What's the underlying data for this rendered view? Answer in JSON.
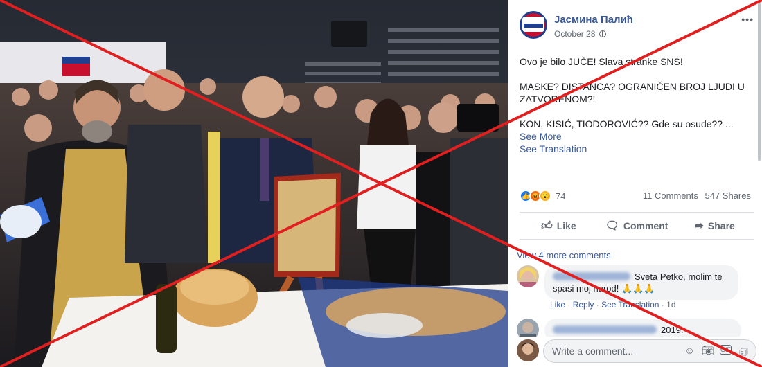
{
  "post": {
    "author": "Јасмина Палић",
    "date": "October 28",
    "paragraphs": [
      "Ovo je bilo JUČE! Slava stranke SNS!",
      "MASKE? DISTANCA? OGRANIČEN BROJ LJUDI U ZATVORENOM?!",
      "KON, KISIĆ, TIODOROVIĆ?? Gde su osude?? ..."
    ],
    "see_more": "See More",
    "see_translation": "See Translation"
  },
  "engagement": {
    "reaction_count": "74",
    "comments": "11 Comments",
    "shares": "547 Shares"
  },
  "actions": {
    "like": "Like",
    "comment": "Comment",
    "share": "Share"
  },
  "comments": {
    "view_more": "View 4 more comments",
    "items": [
      {
        "text": "Sveta Petko, molim te spasi moj narod! 🙏🙏🙏",
        "like": "Like",
        "reply": "Reply",
        "see_translation": "See Translation",
        "time": "1d"
      },
      {
        "text": "2019."
      }
    ],
    "write_placeholder": "Write a comment..."
  },
  "icons": {
    "avatar": "page-avatar",
    "globe": "globe-icon",
    "more": "more-options-icon",
    "reactions": [
      "like-reaction",
      "angry-reaction",
      "wow-reaction"
    ],
    "actions": [
      "thumbs-up-icon",
      "comment-icon",
      "share-icon"
    ],
    "input": [
      "emoji-icon",
      "camera-icon",
      "gif-icon",
      "sticker-icon"
    ]
  },
  "colors": {
    "link": "#385898",
    "overlay_cross": "#e02020",
    "like_blue": "#1877f2"
  }
}
